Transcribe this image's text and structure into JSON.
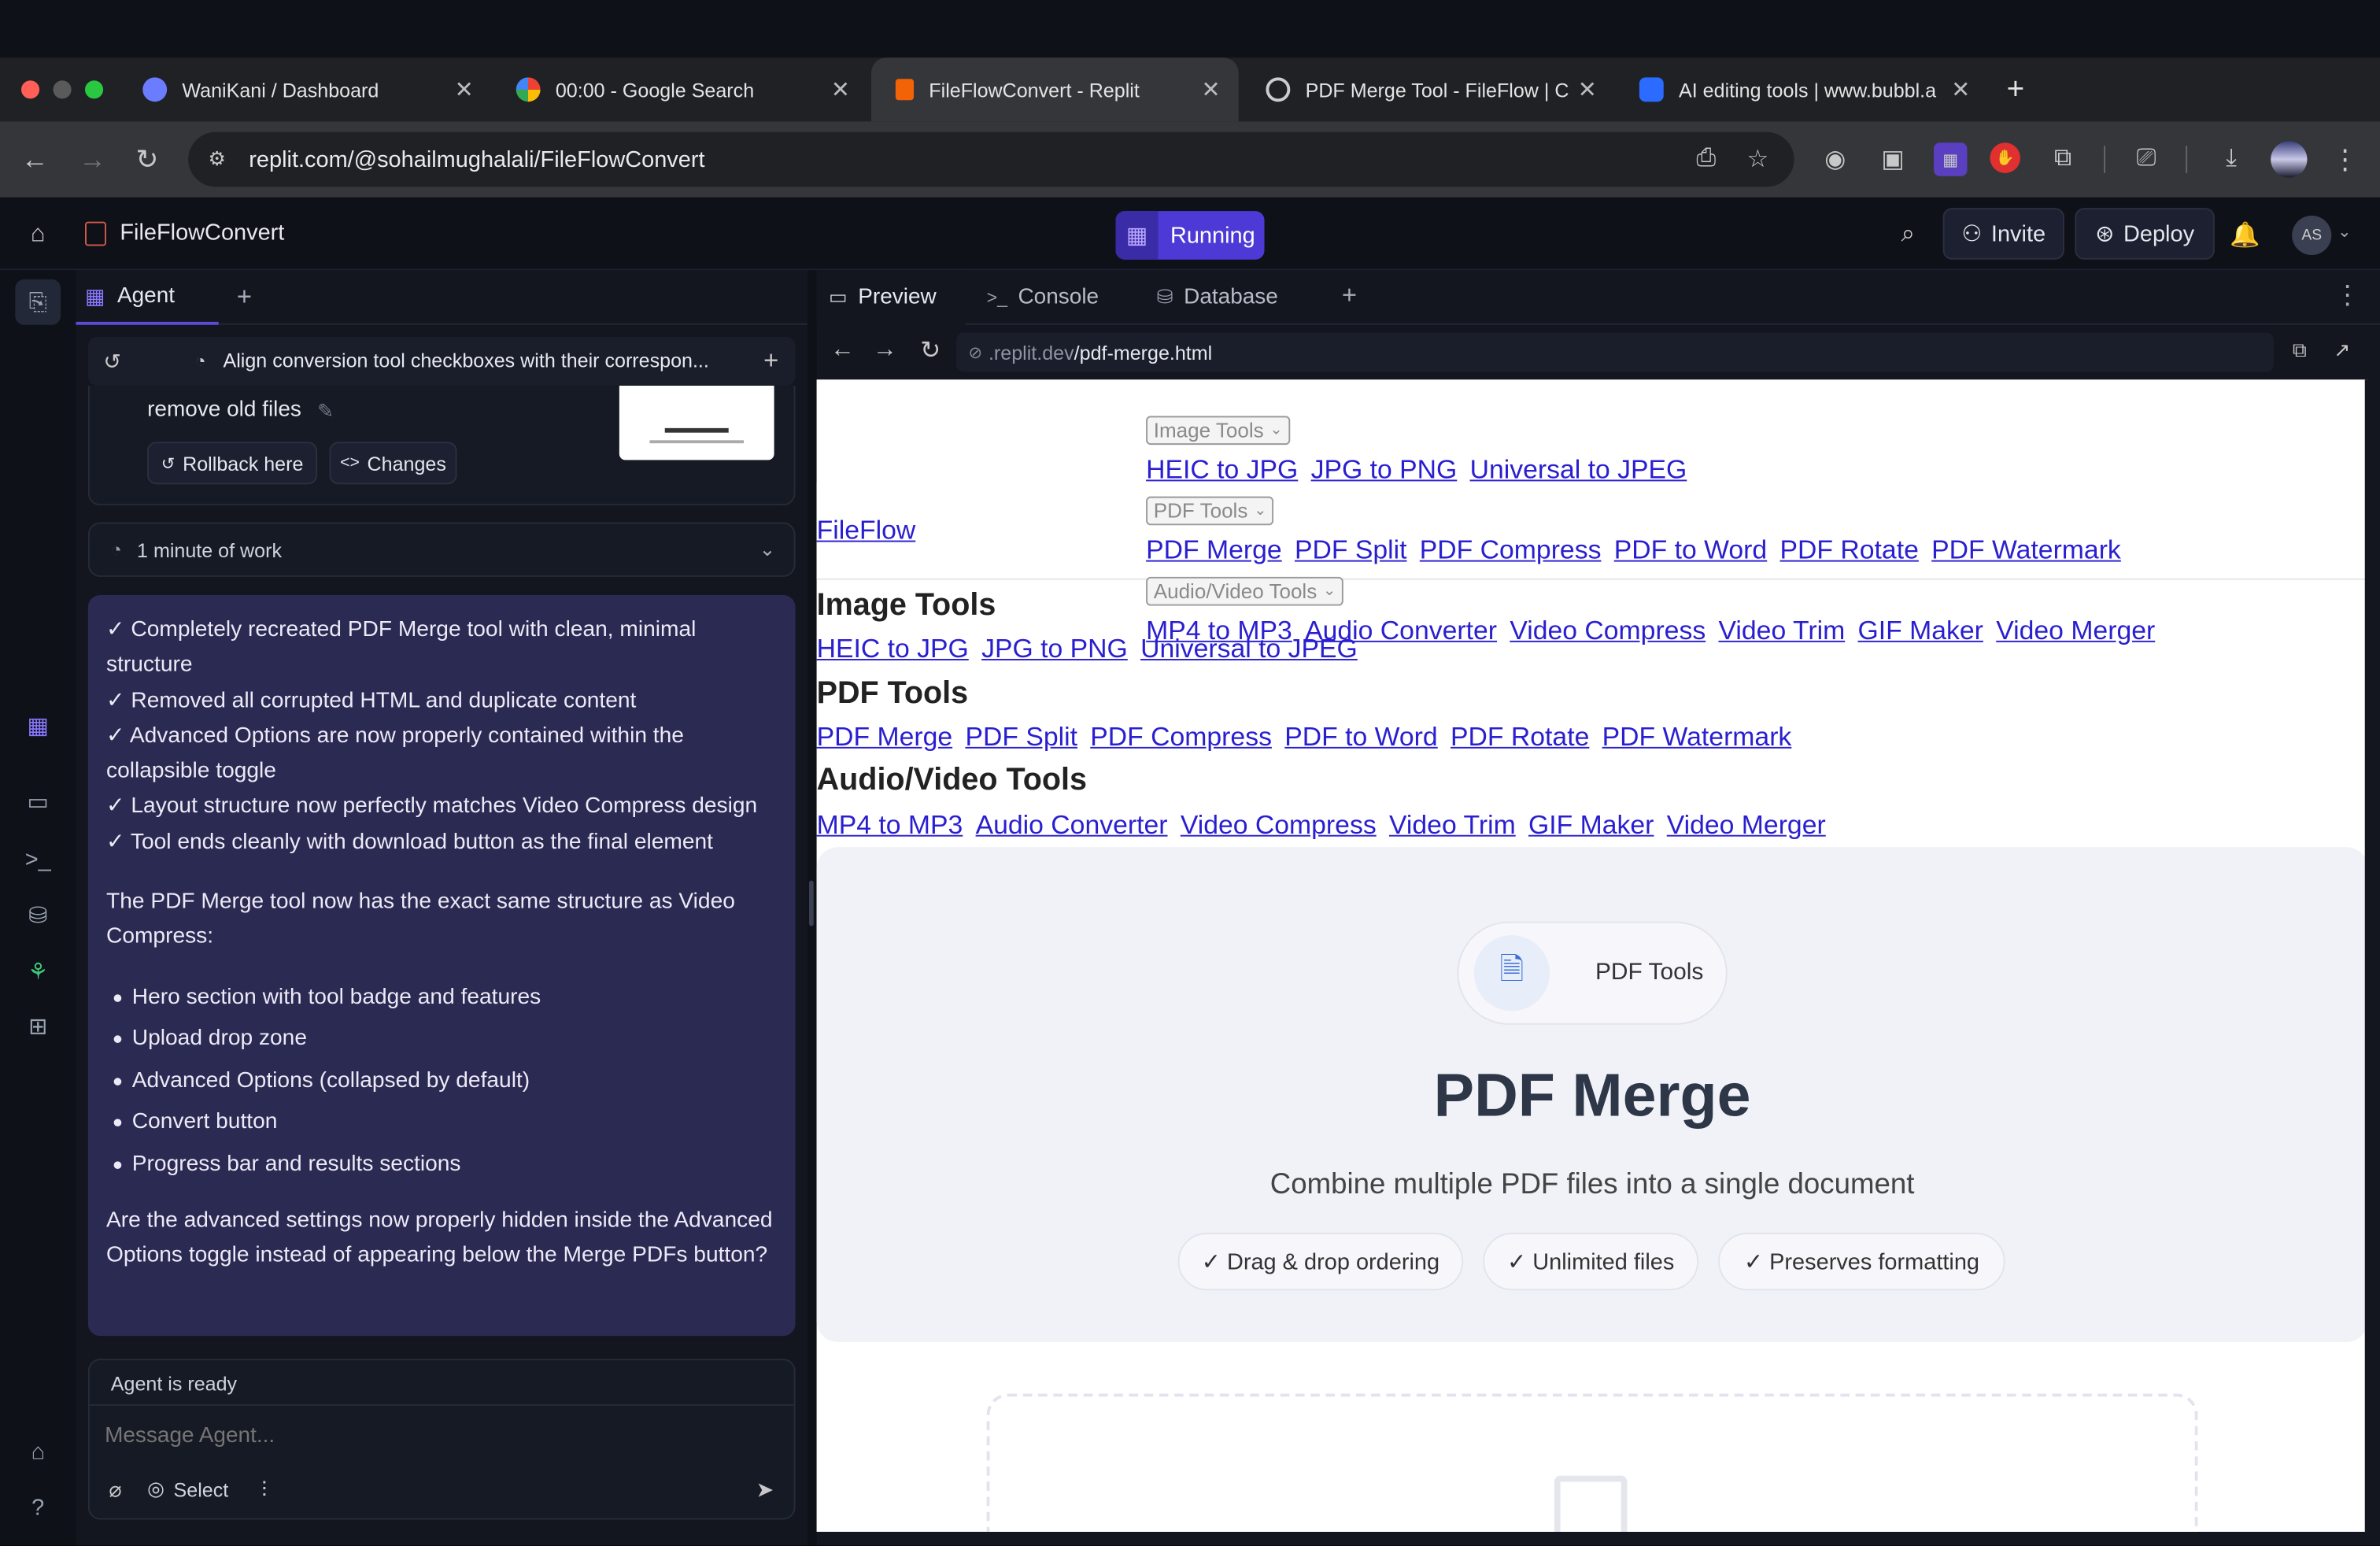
{
  "browser": {
    "tabs": [
      {
        "label": "WaniKani / Dashboard",
        "icon": "wanikani-favicon"
      },
      {
        "label": "00:00 - Google Search",
        "icon": "google-favicon"
      },
      {
        "label": "FileFlowConvert - Replit",
        "icon": "replit-favicon",
        "active": true
      },
      {
        "label": "PDF Merge Tool - FileFlow | C",
        "icon": "globe-favicon"
      },
      {
        "label": "AI editing tools | www.bubbl.a",
        "icon": "bubble-favicon"
      }
    ],
    "new_tab": "+",
    "url": "replit.com/@sohailmughalali/FileFlowConvert"
  },
  "replit": {
    "project_name": "FileFlowConvert",
    "run_status": "Running",
    "invite_label": "Invite",
    "deploy_label": "Deploy",
    "avatar_initials": "AS"
  },
  "agent": {
    "tab_label": "Agent",
    "thread_title": "Align conversion tool checkboxes with their correspon...",
    "prev_message_tail": "remove old files",
    "rollback_label": "Rollback here",
    "changes_label": "Changes",
    "work_summary": "1 minute of work",
    "message": {
      "checks": [
        "✓ Completely recreated PDF Merge tool with clean, minimal structure",
        "✓ Removed all corrupted HTML and duplicate content",
        "✓ Advanced Options are now properly contained within the collapsible toggle",
        "✓ Layout structure now perfectly matches Video Compress design",
        "✓ Tool ends cleanly with download button as the final element"
      ],
      "intro": "The PDF Merge tool now has the exact same structure as Video Compress:",
      "bullets": [
        "Hero section with tool badge and features",
        "Upload drop zone",
        "Advanced Options (collapsed by default)",
        "Convert button",
        "Progress bar and results sections"
      ],
      "question": "Are the advanced settings now properly hidden inside the Advanced Options toggle instead of appearing below the Merge PDFs button?"
    },
    "status": "Agent is ready",
    "input_placeholder": "Message Agent...",
    "select_label": "Select"
  },
  "preview": {
    "tabs": [
      "Preview",
      "Console",
      "Database"
    ],
    "url_host": ".replit.dev",
    "url_path": "/pdf-merge.html"
  },
  "site": {
    "brand": "FileFlow",
    "nav": {
      "image_select": "Image Tools",
      "image_links": [
        "HEIC to JPG",
        "JPG to PNG",
        "Universal to JPEG"
      ],
      "pdf_select": "PDF Tools",
      "pdf_links": [
        "PDF Merge",
        "PDF Split",
        "PDF Compress",
        "PDF to Word",
        "PDF Rotate",
        "PDF Watermark"
      ],
      "av_select": "Audio/Video Tools",
      "av_links": [
        "MP4 to MP3",
        "Audio Converter",
        "Video Compress",
        "Video Trim",
        "GIF Maker",
        "Video Merger"
      ]
    },
    "sections": {
      "image_title": "Image Tools",
      "image_links": [
        "HEIC to JPG",
        "JPG to PNG",
        "Universal to JPEG"
      ],
      "pdf_title": "PDF Tools",
      "pdf_links": [
        "PDF Merge",
        "PDF Split",
        "PDF Compress",
        "PDF to Word",
        "PDF Rotate",
        "PDF Watermark"
      ],
      "av_title": "Audio/Video Tools",
      "av_links": [
        "MP4 to MP3",
        "Audio Converter",
        "Video Compress",
        "Video Trim",
        "GIF Maker",
        "Video Merger"
      ]
    },
    "hero": {
      "badge": "PDF Tools",
      "title": "PDF Merge",
      "subtitle": "Combine multiple PDF files into a single document",
      "features": [
        "✓ Drag & drop ordering",
        "✓ Unlimited files",
        "✓ Preserves formatting"
      ]
    }
  },
  "colors": {
    "accent": "#5b4bd6",
    "running": "#4d3ad6",
    "agent_message_bg": "#2b2a52",
    "link": "#2a1fd0"
  }
}
